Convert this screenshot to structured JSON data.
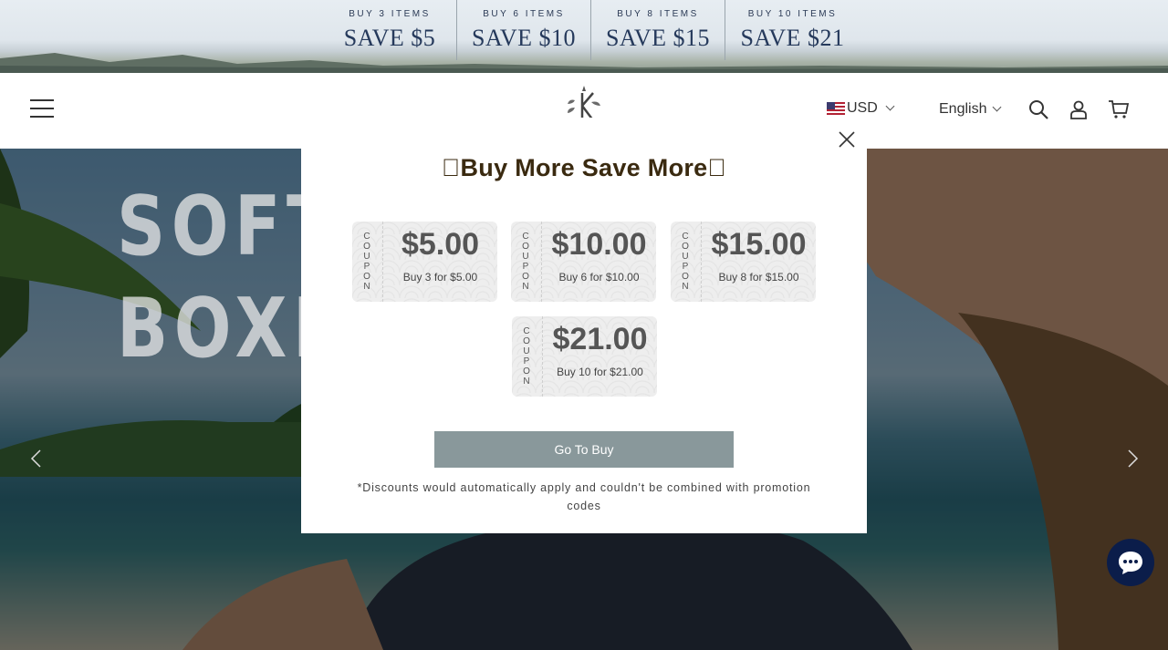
{
  "promo": {
    "items": [
      {
        "small": "BUY 3 ITEMS",
        "big": "SAVE $5"
      },
      {
        "small": "BUY 6 ITEMS",
        "big": "SAVE $10"
      },
      {
        "small": "BUY 8 ITEMS",
        "big": "SAVE $15"
      },
      {
        "small": "BUY 10 ITEMS",
        "big": "SAVE $21"
      }
    ]
  },
  "header": {
    "currency": "USD",
    "language": "English",
    "icons": [
      "menu-icon",
      "logo",
      "search-icon",
      "account-icon",
      "cart-icon"
    ]
  },
  "hero": {
    "title_line1": "SOFT B",
    "title_line2": "BOXER"
  },
  "modal": {
    "title": "\u0000Buy More Save More\u0000",
    "coupon_side_label": "COUPON",
    "coupons": [
      {
        "amount": "$5.00",
        "desc": "Buy 3 for $5.00"
      },
      {
        "amount": "$10.00",
        "desc": "Buy 6 for $10.00"
      },
      {
        "amount": "$15.00",
        "desc": "Buy 8 for $15.00"
      },
      {
        "amount": "$21.00",
        "desc": "Buy 10 for $21.00"
      }
    ],
    "button_label": "Go To Buy",
    "disclaimer": "*Discounts would automatically apply and couldn't be combined with promotion codes"
  },
  "colors": {
    "title": "#3a2a10",
    "button": "#89989b",
    "promo_text": "#263a5c",
    "chat": "#0b1d4a"
  }
}
